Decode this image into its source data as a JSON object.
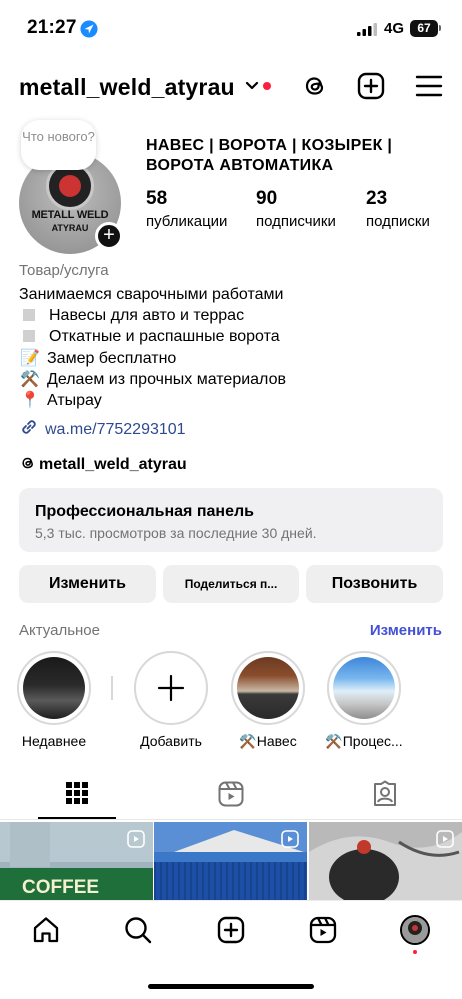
{
  "status_bar": {
    "time": "21:27",
    "network": "4G",
    "battery": "67"
  },
  "header": {
    "username": "metall_weld_atyrau"
  },
  "note": {
    "text": "Что нового?"
  },
  "avatar": {
    "line1": "METALL WELD",
    "line2": "ATYRAU"
  },
  "profile": {
    "business_name": "НАВЕС | ВОРОТА | КОЗЫРЕК | ВОРОТА АВТОМАТИКА",
    "stats": [
      {
        "value": "58",
        "label": "публикации"
      },
      {
        "value": "90",
        "label": "подписчики"
      },
      {
        "value": "23",
        "label": "подписки"
      }
    ]
  },
  "bio": {
    "category": "Товар/услуга",
    "lines": [
      "Занимаемся сварочными работами",
      "Навесы для авто и террас",
      "Откатные и распашные ворота",
      "Замер бесплатно",
      "Делаем из прочных материалов",
      "Атырау"
    ],
    "emoji": [
      "📝",
      "⚒️",
      "📍"
    ],
    "link": "wa.me/7752293101",
    "threads_handle": "metall_weld_atyrau"
  },
  "pro_panel": {
    "title": "Профессиональная панель",
    "subtitle": "5,3 тыс. просмотров за последние 30 дней."
  },
  "buttons": {
    "edit": "Изменить",
    "share": "Поделиться п...",
    "call": "Позвонить"
  },
  "highlights": {
    "title": "Актуальное",
    "edit": "Изменить",
    "items": [
      {
        "label": "Недавнее"
      },
      {
        "label": "Добавить"
      },
      {
        "label": "⚒️Навес"
      },
      {
        "label": "⚒️Процес..."
      }
    ]
  },
  "grid": {
    "cells": [
      {
        "caption": "COFFEE"
      },
      {
        "caption": ""
      },
      {
        "caption": ""
      }
    ]
  },
  "colors": {
    "accent": "#4450d6",
    "link": "#2e4a8f",
    "notify": "#ff1e3c",
    "panel": "#f0f0f2"
  },
  "icons": [
    "location-arrow-icon",
    "signal-icon",
    "chevron-down-icon",
    "threads-icon",
    "plus-square-icon",
    "menu-icon",
    "link-icon",
    "grid-icon",
    "reels-icon",
    "tagged-icon",
    "home-icon",
    "search-icon",
    "create-icon",
    "reels-nav-icon"
  ]
}
